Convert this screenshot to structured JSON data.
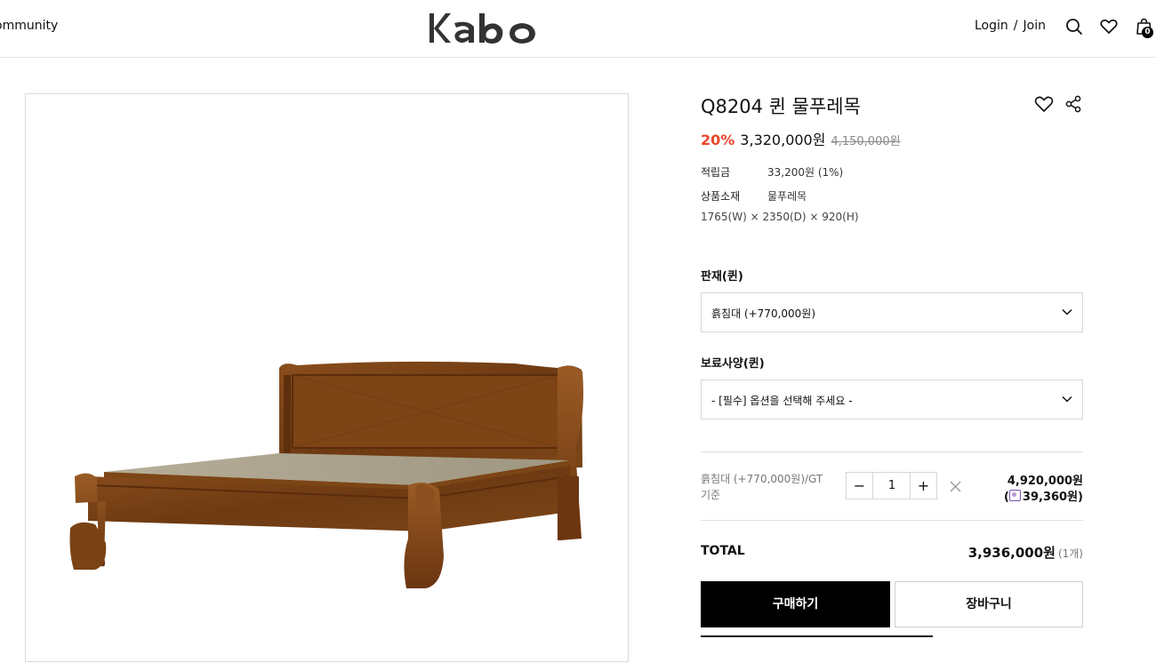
{
  "header": {
    "nav_community": "ommunity",
    "logo_text": "Kabo",
    "login": "Login",
    "separator": "/",
    "join": "Join",
    "cart_count": "0"
  },
  "product": {
    "title": "Q8204 퀸 물푸레목",
    "discount": "20%",
    "price": "3,320,000원",
    "original_price": "4,150,000원",
    "info": [
      {
        "label": "적립금",
        "value": "33,200원 (1%)"
      },
      {
        "label": "상품소재",
        "value": "물푸레목"
      }
    ],
    "dimensions": "1765(W) × 2350(D) × 920(H)"
  },
  "options": [
    {
      "label": "판재(퀸)",
      "selected": "흙침대 (+770,000원)"
    },
    {
      "label": "보료사양(퀸)",
      "selected": "- [필수] 옵션을 선택해 주세요 -"
    }
  ],
  "selected_item": {
    "name": "흙침대 (+770,000원)/GT기준",
    "quantity": "1",
    "price": "4,920,000원",
    "points": "39,360원)"
  },
  "total": {
    "label": "TOTAL",
    "amount": "3,936,000원",
    "count": "(1개)"
  },
  "buttons": {
    "buy": "구매하기",
    "cart": "장바구니"
  },
  "colors": {
    "accent_discount": "#e8462a",
    "buy_button_bg": "#000000"
  }
}
